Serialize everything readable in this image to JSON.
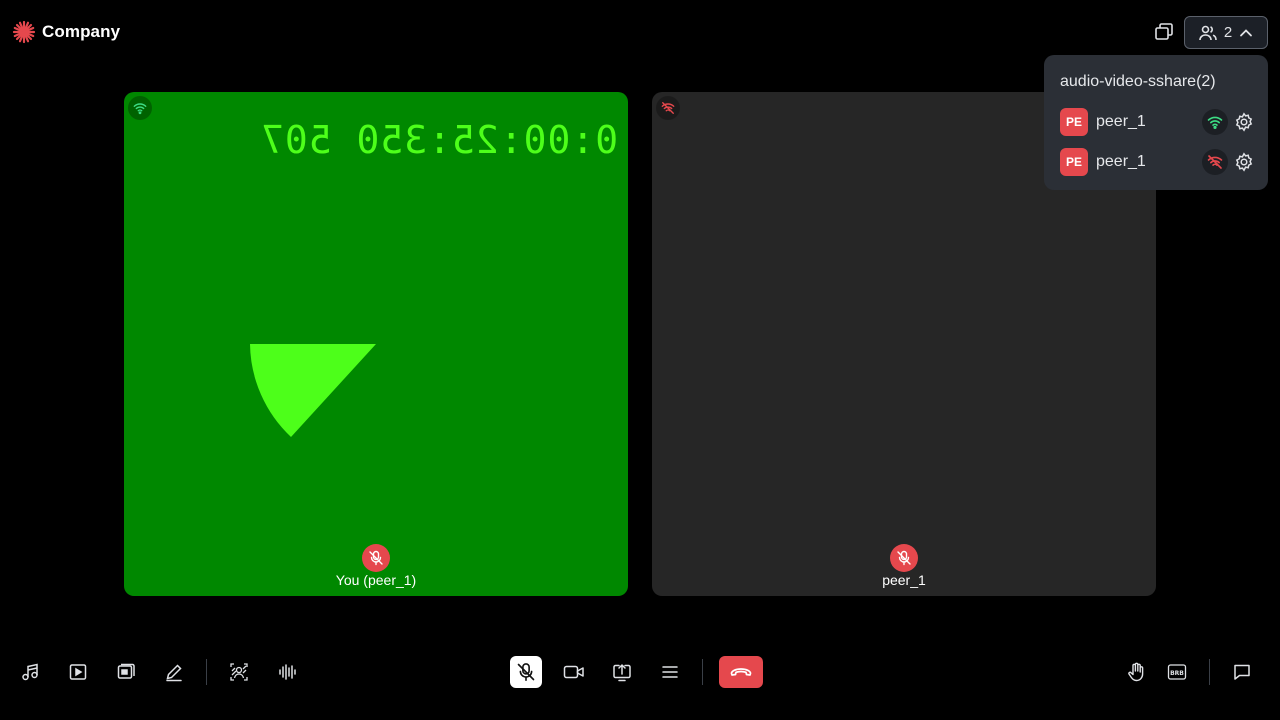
{
  "brand": {
    "name": "Company",
    "accent": "#e5484d"
  },
  "header": {
    "participant_count": "2"
  },
  "tiles": [
    {
      "name": "You (peer_1)",
      "timecode": "0:00:25:350 507",
      "background": "#008800",
      "network": "good",
      "muted": true
    },
    {
      "name": "peer_1",
      "background": "#262626",
      "network": "disconnected",
      "muted": true
    }
  ],
  "participants_panel": {
    "title": "audio-video-sshare(2)",
    "peers": [
      {
        "initials": "PE",
        "name": "peer_1",
        "network": "good"
      },
      {
        "initials": "PE",
        "name": "peer_1",
        "network": "disconnected"
      }
    ]
  },
  "toolbar": {
    "left": [
      "music-icon",
      "play-video-icon",
      "screen-share-video-icon",
      "pencil-icon",
      "virtual-background-icon",
      "audio-wave-icon"
    ],
    "center": [
      "mic-off-icon",
      "video-icon",
      "share-screen-icon",
      "more-icon",
      "leave-icon"
    ],
    "right": [
      "hand-raise-icon",
      "brb-icon",
      "chat-icon"
    ]
  },
  "colors": {
    "good": "#3ddc84",
    "bad": "#e5484d",
    "timecode": "#4dff1a"
  }
}
